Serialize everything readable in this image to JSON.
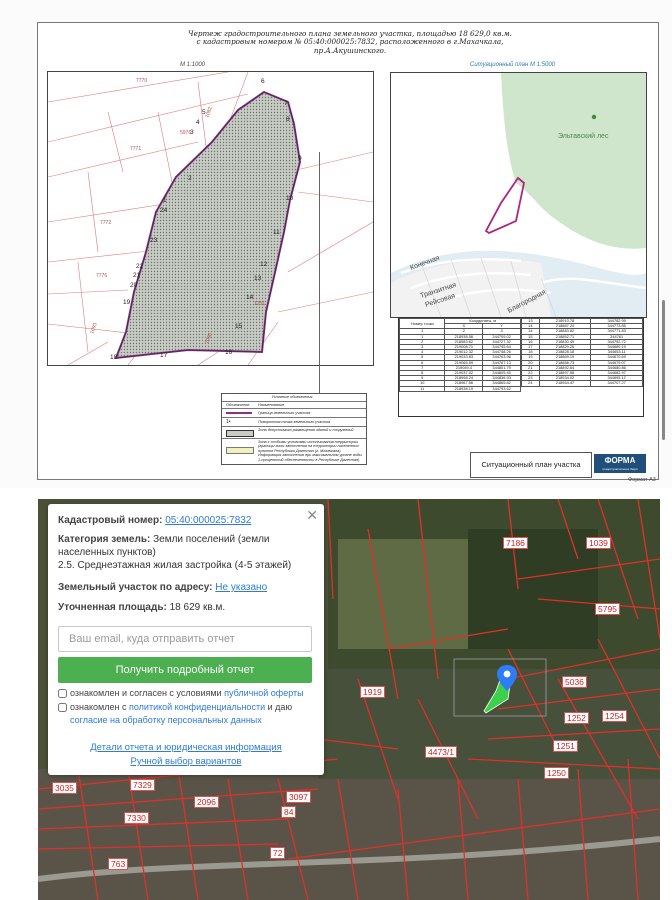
{
  "drawing": {
    "title_lines": [
      "Чертеж градостроительного плана земельного участка,    площадью 18 629,0 кв.м.",
      "с кадастровым номером   № 05:40:000025:7832, расположенного в г.Махачкала,",
      "пр.А.Акушинского."
    ],
    "left_scale": "М 1:1000",
    "situ_scale": "Ситуационный план М 1:5000",
    "point_labels": [
      "1",
      "2",
      "3",
      "4",
      "5",
      "6",
      "7",
      "8",
      "9",
      "10",
      "11",
      "12",
      "13",
      "14",
      "15",
      "16",
      "17",
      "18",
      "19",
      "20",
      "21",
      "22",
      "23",
      "24"
    ],
    "parcel_labels": [
      "7770",
      "5976",
      "7771",
      "7772",
      "7776",
      "5983",
      "1251",
      "1082",
      "1090",
      "1093"
    ],
    "situ_labels": {
      "forest": "Эльтавский лес",
      "street1": "Конечная",
      "street2": "Транзитная",
      "street3": "Рейсовая",
      "street4": "Благородная"
    },
    "legend": {
      "title": "Условные обозначения",
      "col1": "Обозначение",
      "col2": "Наименование",
      "rows": [
        "Граница земельного участка",
        "Поворотная точка земельного участка",
        "Зона допустимого размещения зданий и сооружений",
        "Зона с особыми условиями использования территории (границы зоны затопления на территории населенных пунктов Республики Дагестан (г. Махачкала). Информация затопления при максимальном уровне воды 1-процентной обеспеченности в Республике Дагестан)"
      ],
      "row2_symbol": "1•"
    },
    "coord_table": {
      "header": [
        "Номер точки",
        "Координаты, м",
        "X",
        "Y",
        "1",
        "2",
        "3"
      ],
      "left_rows": [
        [
          "1",
          "218938.56",
          "344709.02"
        ],
        [
          "2",
          "218983.62",
          "344727.32"
        ],
        [
          "3",
          "219008.71",
          "344745.64"
        ],
        [
          "4",
          "219012.32",
          "344748.26"
        ],
        [
          "5",
          "219033.83",
          "344763.96"
        ],
        [
          "6",
          "219065.59",
          "344787.13"
        ],
        [
          "7",
          "219049.4",
          "344801.79"
        ],
        [
          "8",
          "219037.02",
          "344805.45"
        ],
        [
          "9",
          "218998.24",
          "344836.93"
        ],
        [
          "10",
          "218967.56",
          "344865.82"
        ],
        [
          "11",
          "218938.19",
          "344793.62"
        ]
      ],
      "right_rows": [
        [
          "13",
          "218910.78",
          "344782.99"
        ],
        [
          "14",
          "218887.24",
          "344773.85"
        ],
        [
          "14",
          "218883.82",
          "344771.83"
        ],
        [
          "15",
          "218852.71",
          "344761"
        ],
        [
          "16",
          "218830.49",
          "344752.72"
        ],
        [
          "17",
          "218829.26",
          "344689.19"
        ],
        [
          "18",
          "218828.18",
          "344653.11"
        ],
        [
          "19",
          "218869.19",
          "344670.69"
        ],
        [
          "20",
          "218888.73",
          "344679.07"
        ],
        [
          "21",
          "218892.64",
          "344680.86"
        ],
        [
          "22",
          "218897.58",
          "344682.97"
        ],
        [
          "23",
          "218934.02",
          "344695.12"
        ],
        [
          "24",
          "218954.47",
          "344707.27"
        ]
      ]
    },
    "stamp_title": "Ситуационный план участка",
    "stamp_logo": "ФОРМА",
    "stamp_logo_sub": "градостроительное бюро",
    "format_label": "Формат А3"
  },
  "panel": {
    "cadastral_label": "Кадастровый номер:",
    "cadastral_value": "05:40:000025:7832",
    "category_label": "Категория земель:",
    "category_value_1": "Земли поселений (земли",
    "category_value_2": "населенных пунктов)",
    "use_value": "2.5. Среднеэтажная жилая застройка (4-5 этажей)",
    "address_label": "Земельный участок по адресу:",
    "address_value": "Не указано",
    "area_label": "Уточненная площадь:",
    "area_value": "18 629 кв.м.",
    "email_placeholder": "Ваш email, куда отправить отчет",
    "report_button": "Получить подробный отчет",
    "agree1_text": "ознакомлен и согласен с условиями",
    "agree1_link": "публичной оферты",
    "agree2_text": "ознакомлен с",
    "agree2_link": "политикой конфиденциальности",
    "agree2_text2": "и даю",
    "agree2_link2": "согласие на обработку персональных данных",
    "details_link": "Детали отчета и юридическая информация",
    "manual_link": "Ручной выбор вариантов",
    "close": "✕"
  },
  "map_labels": [
    "7186",
    "1039",
    "5795",
    "5036",
    "1919",
    "1252",
    "1254",
    "1251",
    "4473/1",
    "1250",
    "3035",
    "7329",
    "2096",
    "3097",
    "84",
    "7330",
    "763",
    "72"
  ]
}
